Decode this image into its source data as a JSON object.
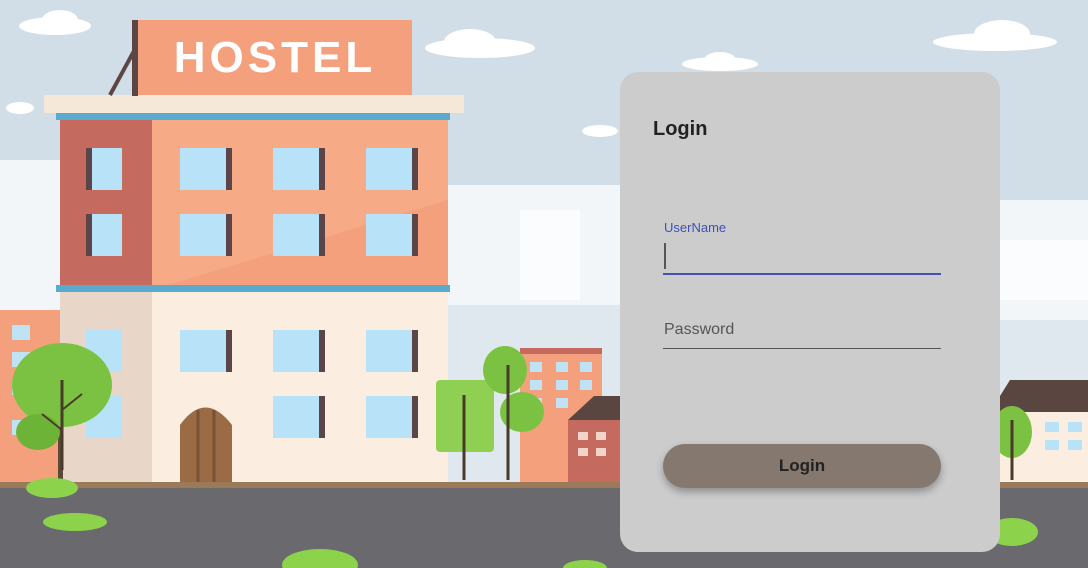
{
  "background": {
    "sign_text": "HOSTEL",
    "colors": {
      "sky": "#dfe8ee",
      "road": "#6a6a6e",
      "hostel_facade": "#f4a07c",
      "hostel_sign": "#f4a07c",
      "tree_green": "#7cc242"
    }
  },
  "login": {
    "title": "Login",
    "username": {
      "label": "UserName",
      "value": ""
    },
    "password": {
      "placeholder": "Password",
      "value": ""
    },
    "submit_label": "Login",
    "colors": {
      "card": "#cccccc",
      "accent": "#3f51b5",
      "button": "#84786f"
    }
  }
}
